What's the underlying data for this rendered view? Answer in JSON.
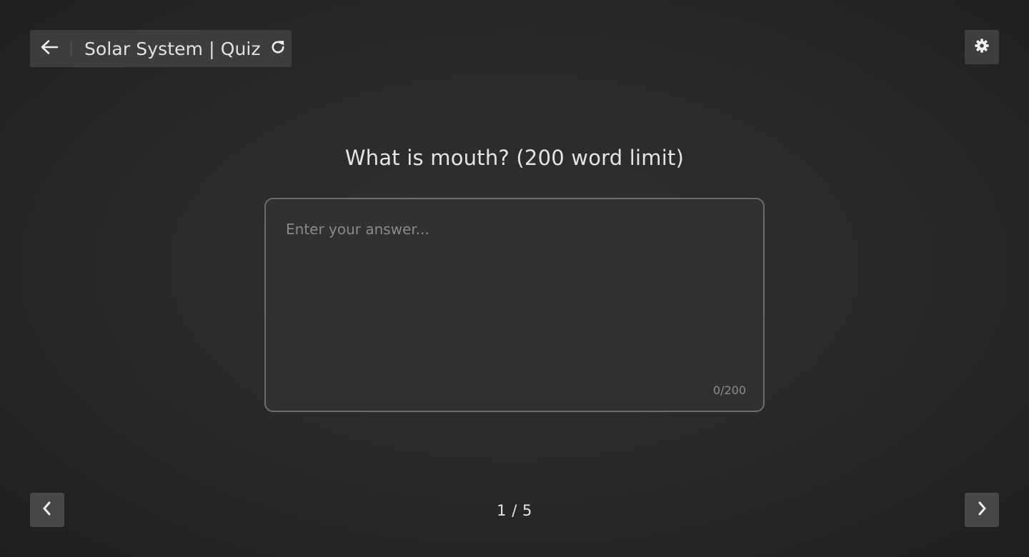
{
  "header": {
    "title": "Solar System | Quiz",
    "back_icon": "arrow-left-icon",
    "refresh_icon": "refresh-icon"
  },
  "settings": {
    "icon": "gear-icon"
  },
  "question": {
    "text": "What is mouth? (200 word limit)"
  },
  "answer": {
    "value": "",
    "placeholder": "Enter your answer...",
    "counter": "0/200"
  },
  "navigation": {
    "prev_icon": "chevron-left-icon",
    "next_icon": "chevron-right-icon",
    "page_indicator": "1 / 5"
  },
  "colors": {
    "background": "#2a2a2a",
    "panel": "#3d3d3d",
    "input_border": "#6d6d6d",
    "text": "#e6e6e6",
    "muted_text": "#8a8a8a"
  }
}
